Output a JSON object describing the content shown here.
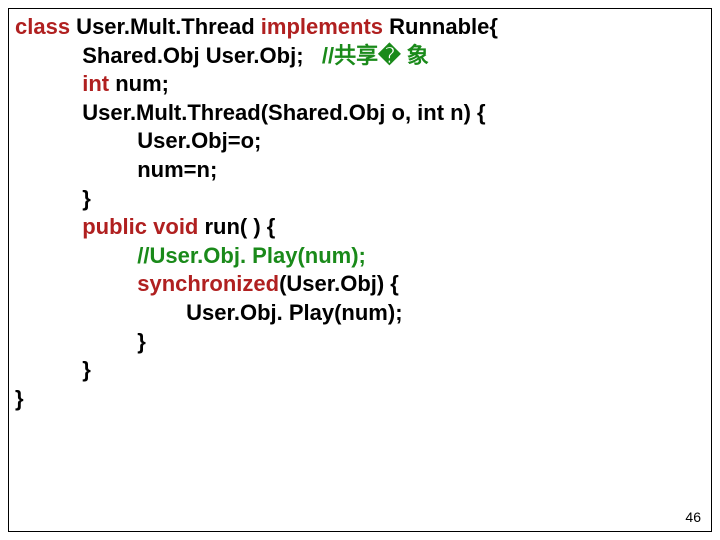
{
  "code": {
    "l1a": "class",
    "l1b": " User.Mult.Thread ",
    "l1c": "implements",
    "l1d": " Runnable{",
    "l2a": "           Shared.Obj User.Obj;   ",
    "l2b": "//共享� 象",
    "l3": "           int",
    "l3b": " num;",
    "l4": "",
    "l5": "           User.Mult.Thread(Shared.Obj o, int n) {",
    "l6": "                    User.Obj=o;",
    "l7": "                    num=n;",
    "l8": "           }",
    "l9": "",
    "l10a": "           public",
    "l10b": " ",
    "l10c": "void",
    "l10d": " run( ) {",
    "l11a": "                    ",
    "l11b": "//User.Obj. Play(num);",
    "l12a": "                    synchronized",
    "l12b": "(User.Obj) {",
    "l13": "                            User.Obj. Play(num);",
    "l14": "                    }",
    "l15": "",
    "l16": "           }",
    "l17": "}"
  },
  "page_number": "46"
}
